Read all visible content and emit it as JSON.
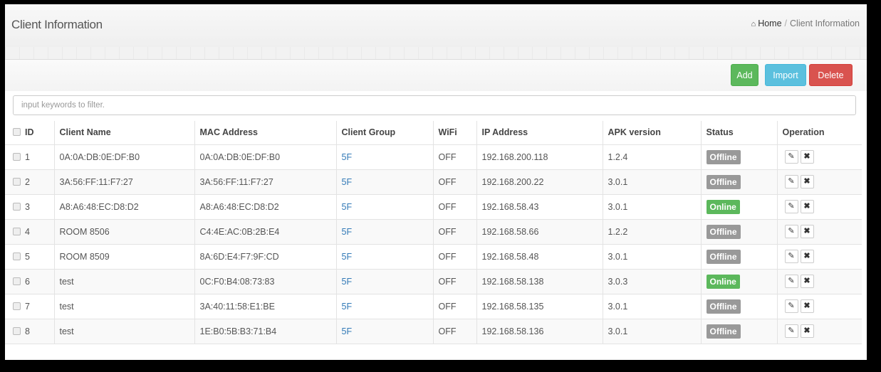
{
  "header": {
    "title": "Client Information",
    "breadcrumb": {
      "home": "Home",
      "separator": "/",
      "current": "Client Information"
    }
  },
  "toolbar": {
    "add_label": "Add",
    "import_label": "Import",
    "delete_label": "Delete"
  },
  "filter": {
    "placeholder": "input keywords to filter.",
    "value": ""
  },
  "colors": {
    "add": "#5cb85c",
    "import": "#5bc0de",
    "delete": "#d9534f",
    "offline": "#999999",
    "online": "#5cb85c",
    "link": "#337ab7"
  },
  "table": {
    "columns": [
      "ID",
      "Client Name",
      "MAC Address",
      "Client Group",
      "WiFi",
      "IP Address",
      "APK version",
      "Status",
      "Operation"
    ],
    "rows": [
      {
        "id": "1",
        "name": "0A:0A:DB:0E:DF:B0",
        "mac": "0A:0A:DB:0E:DF:B0",
        "group": "5F",
        "wifi": "OFF",
        "ip": "192.168.200.118",
        "apk": "1.2.4",
        "status": "Offline"
      },
      {
        "id": "2",
        "name": "3A:56:FF:11:F7:27",
        "mac": "3A:56:FF:11:F7:27",
        "group": "5F",
        "wifi": "OFF",
        "ip": "192.168.200.22",
        "apk": "3.0.1",
        "status": "Offline"
      },
      {
        "id": "3",
        "name": "A8:A6:48:EC:D8:D2",
        "mac": "A8:A6:48:EC:D8:D2",
        "group": "5F",
        "wifi": "OFF",
        "ip": "192.168.58.43",
        "apk": "3.0.1",
        "status": "Online"
      },
      {
        "id": "4",
        "name": "ROOM 8506",
        "mac": "C4:4E:AC:0B:2B:E4",
        "group": "5F",
        "wifi": "OFF",
        "ip": "192.168.58.66",
        "apk": "1.2.2",
        "status": "Offline"
      },
      {
        "id": "5",
        "name": "ROOM 8509",
        "mac": "8A:6D:E4:F7:9F:CD",
        "group": "5F",
        "wifi": "OFF",
        "ip": "192.168.58.48",
        "apk": "3.0.1",
        "status": "Offline"
      },
      {
        "id": "6",
        "name": "test",
        "mac": "0C:F0:B4:08:73:83",
        "group": "5F",
        "wifi": "OFF",
        "ip": "192.168.58.138",
        "apk": "3.0.3",
        "status": "Online"
      },
      {
        "id": "7",
        "name": "test",
        "mac": "3A:40:11:58:E1:BE",
        "group": "5F",
        "wifi": "OFF",
        "ip": "192.168.58.135",
        "apk": "3.0.1",
        "status": "Offline"
      },
      {
        "id": "8",
        "name": "test",
        "mac": "1E:B0:5B:B3:71:B4",
        "group": "5F",
        "wifi": "OFF",
        "ip": "192.168.58.136",
        "apk": "3.0.1",
        "status": "Offline"
      }
    ],
    "icons": {
      "edit": "pencil-icon",
      "delete": "close-icon",
      "home": "home-icon"
    }
  }
}
